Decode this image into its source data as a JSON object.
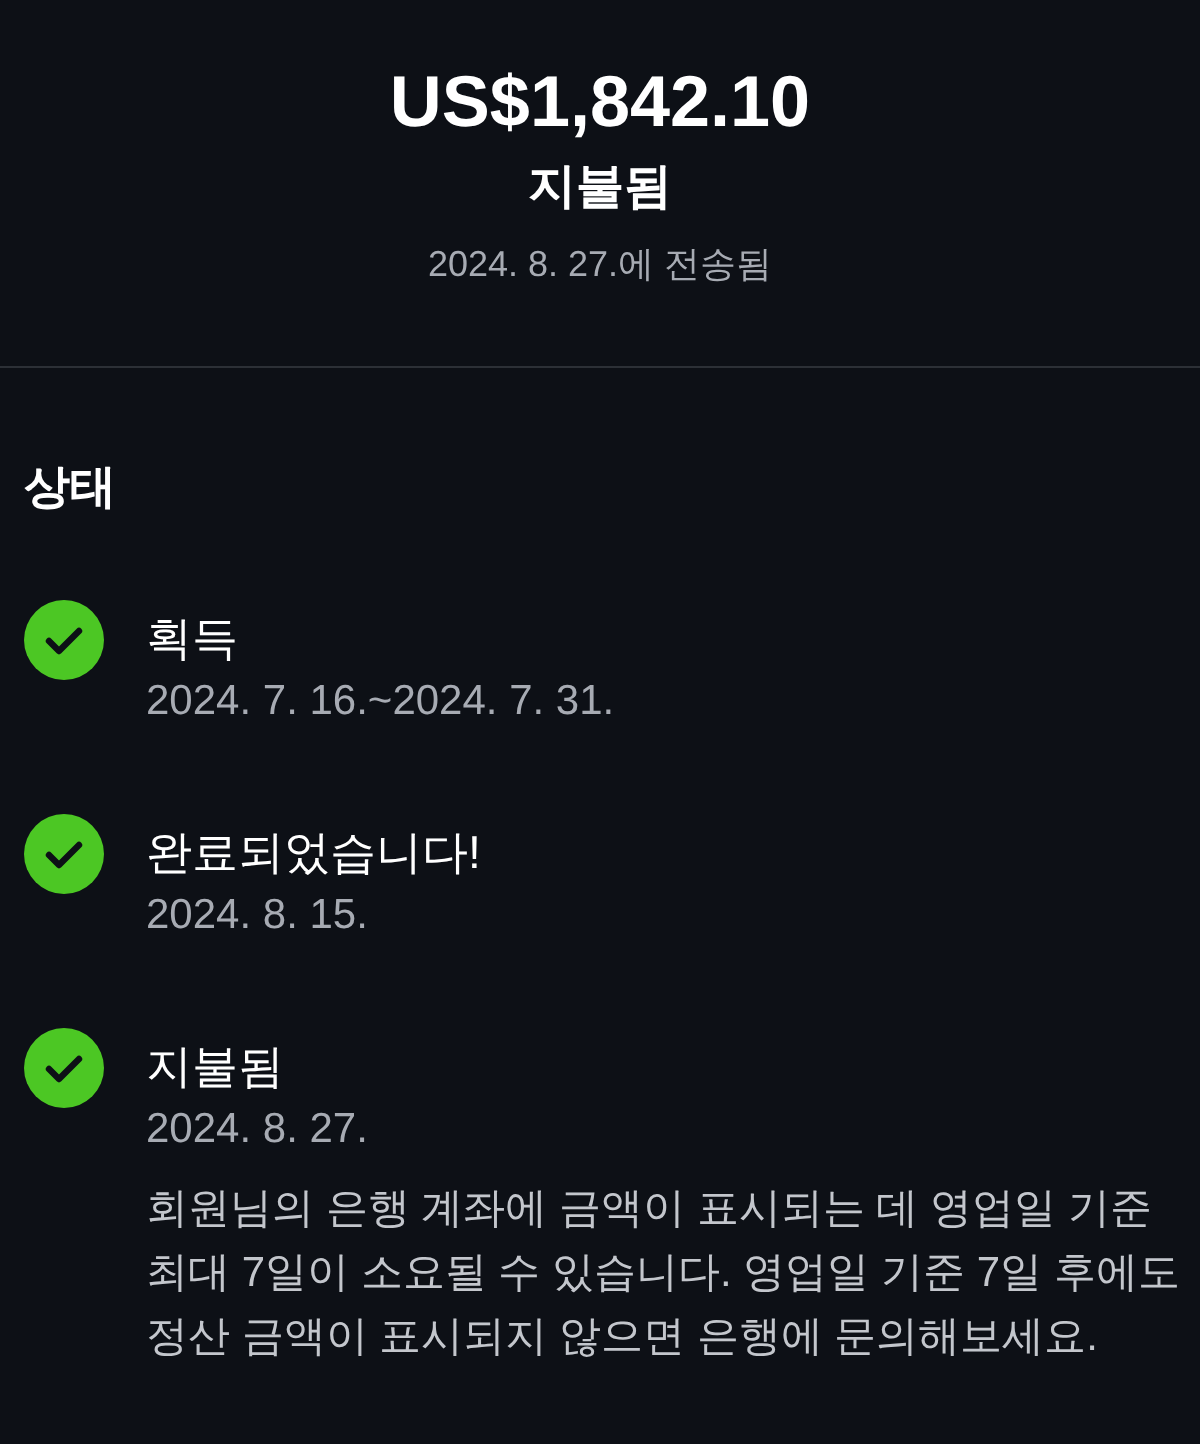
{
  "summary": {
    "amount": "US$1,842.10",
    "status": "지불됨",
    "sent_date": "2024. 8. 27.에 전송됨"
  },
  "status_section": {
    "title": "상태",
    "steps": [
      {
        "title": "획득",
        "date": "2024. 7. 16.~2024. 7. 31.",
        "completed": true
      },
      {
        "title": "완료되었습니다!",
        "date": "2024. 8. 15.",
        "completed": true
      },
      {
        "title": "지불됨",
        "date": "2024. 8. 27.",
        "completed": true,
        "description": "회원님의 은행 계좌에 금액이 표시되는 데 영업일 기준 최대 7일이 소요될 수 있습니다. 영업일 기준 7일 후에도 정산 금액이 표시되지 않으면 은행에 문의해보세요."
      }
    ]
  }
}
